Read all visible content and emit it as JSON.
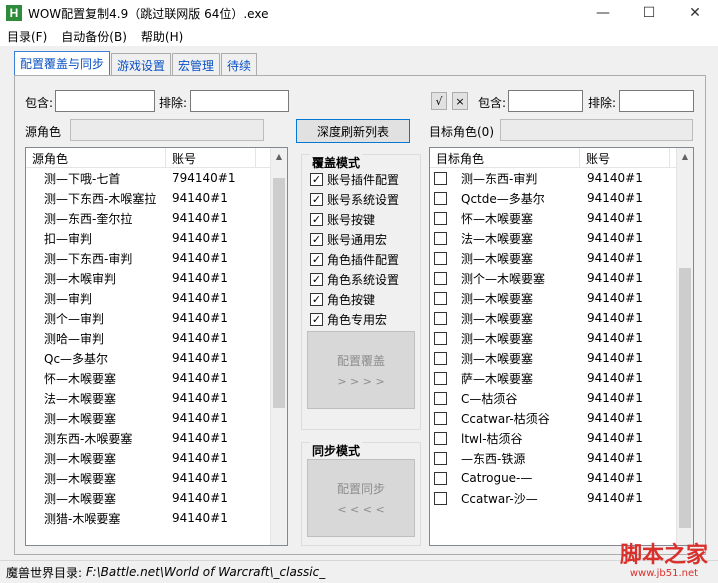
{
  "window": {
    "title": "WOW配置复制4.9（跳过联网版 64位）.exe",
    "app_icon": "H",
    "minimize": "—",
    "maximize": "☐",
    "close": "✕"
  },
  "menu": [
    "目录(F)",
    "自动备份(B)",
    "帮助(H)"
  ],
  "tabs": [
    "配置覆盖与同步",
    "游戏设置",
    "宏管理",
    "待续"
  ],
  "filters_left": {
    "include_label": "包含:",
    "exclude_label": "排除:",
    "include_value": "",
    "exclude_value": ""
  },
  "filters_right": {
    "check_all": "√",
    "clear_all": "×",
    "include_label": "包含:",
    "exclude_label": "排除:",
    "include_value": "",
    "exclude_value": ""
  },
  "source_role_label": "源角色",
  "refresh_button": "深度刷新列表",
  "target_role_label": "目标角色(0)",
  "source_list": {
    "headers": [
      "源角色",
      "账号"
    ],
    "rows": [
      [
        "测—下哦-七首",
        "794140#1"
      ],
      [
        "测—下东西-木喉塞拉",
        "94140#1"
      ],
      [
        "测—东西-奎尔拉",
        "94140#1"
      ],
      [
        "扣—审判",
        "94140#1"
      ],
      [
        "测—下东西-审判",
        "94140#1"
      ],
      [
        "测—木喉审判",
        "94140#1"
      ],
      [
        "测—审判",
        "94140#1"
      ],
      [
        "测个—审判",
        "94140#1"
      ],
      [
        "测哈—审判",
        "94140#1"
      ],
      [
        "Qc—多基尔",
        "94140#1"
      ],
      [
        "怀—木喉要塞",
        "94140#1"
      ],
      [
        "法—木喉要塞",
        "94140#1"
      ],
      [
        "测—木喉要塞",
        "94140#1"
      ],
      [
        "测东西-木喉要塞",
        "94140#1"
      ],
      [
        "测—木喉要塞",
        "94140#1"
      ],
      [
        "测—木喉要塞",
        "94140#1"
      ],
      [
        "测—木喉要塞",
        "94140#1"
      ],
      [
        "测猎-木喉要塞",
        "94140#1"
      ]
    ]
  },
  "override_mode": {
    "title": "覆盖模式",
    "options": [
      {
        "label": "账号插件配置",
        "checked": true
      },
      {
        "label": "账号系统设置",
        "checked": true
      },
      {
        "label": "账号按键",
        "checked": true
      },
      {
        "label": "账号通用宏",
        "checked": true
      },
      {
        "label": "角色插件配置",
        "checked": true
      },
      {
        "label": "角色系统设置",
        "checked": true
      },
      {
        "label": "角色按键",
        "checked": true
      },
      {
        "label": "角色专用宏",
        "checked": true
      }
    ],
    "apply_button": "配置覆盖",
    "apply_arrows": "> > > >"
  },
  "sync_mode": {
    "title": "同步模式",
    "apply_button": "配置同步",
    "apply_arrows": "< < < <"
  },
  "target_list": {
    "headers": [
      "目标角色",
      "账号"
    ],
    "rows": [
      [
        "测—东西-审判",
        "94140#1"
      ],
      [
        "Qctde—多基尔",
        "94140#1"
      ],
      [
        "怀—木喉要塞",
        "94140#1"
      ],
      [
        "法—木喉要塞",
        "94140#1"
      ],
      [
        "测—木喉要塞",
        "94140#1"
      ],
      [
        "测个—木喉要塞",
        "94140#1"
      ],
      [
        "测—木喉要塞",
        "94140#1"
      ],
      [
        "测—木喉要塞",
        "94140#1"
      ],
      [
        "测—木喉要塞",
        "94140#1"
      ],
      [
        "测—木喉要塞",
        "94140#1"
      ],
      [
        "萨—木喉要塞",
        "94140#1"
      ],
      [
        "C—枯须谷",
        "94140#1"
      ],
      [
        "Ccatwar-枯须谷",
        "94140#1"
      ],
      [
        "ltwl-枯须谷",
        "94140#1"
      ],
      [
        "—东西-铁源",
        "94140#1"
      ],
      [
        "Catrogue-—",
        "94140#1"
      ],
      [
        "Ccatwar-沙—",
        "94140#1"
      ]
    ]
  },
  "status": {
    "label": "魔兽世界目录:",
    "path": "F:\\Battle.net\\World of Warcraft\\_classic_"
  },
  "watermark": {
    "main": "脚本之家",
    "sub": "www.jb51.net"
  }
}
